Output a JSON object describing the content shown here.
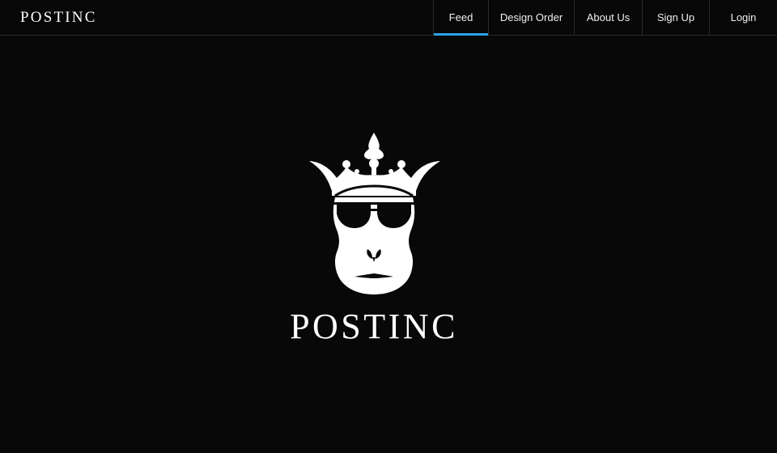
{
  "header": {
    "brand": "POSTINC",
    "nav": [
      {
        "label": "Feed",
        "active": true
      },
      {
        "label": "Design Order",
        "active": false
      },
      {
        "label": "About Us",
        "active": false
      },
      {
        "label": "Sign Up",
        "active": false
      },
      {
        "label": "Login",
        "active": false
      }
    ]
  },
  "hero": {
    "logo_icon": "crowned-monkey-sunglasses-icon",
    "logo_wordmark": "POSTINC"
  },
  "colors": {
    "background": "#080808",
    "text": "#ffffff",
    "accent": "#29a3e6",
    "divider": "#2a2a2a"
  }
}
